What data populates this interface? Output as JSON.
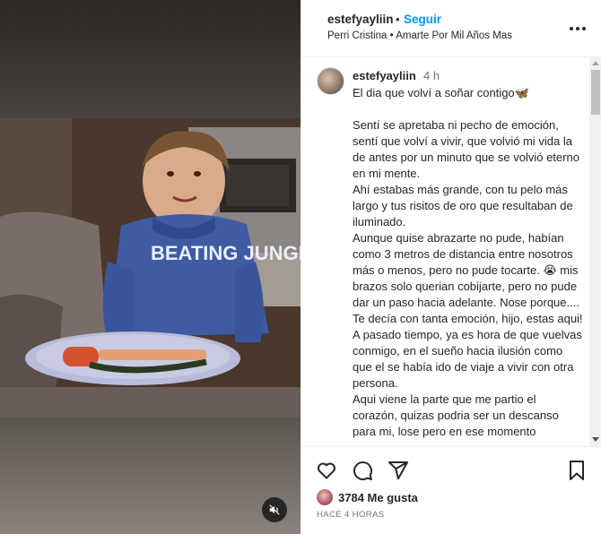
{
  "media": {
    "mute_icon": "speaker-muted-icon",
    "shirt_text": "BEATING JUNGLE"
  },
  "header": {
    "username": "estefyayliin",
    "separator": "•",
    "follow_label": "Seguir",
    "audio": "Perri Cristina • Amarte Por Mil Años Mas",
    "more_icon": "more-options-icon"
  },
  "comment": {
    "username": "estefyayliin",
    "time": "4 h",
    "caption": "El dia que volví a soñar contigo🦋\n\nSentí se apretaba ni pecho de emoción, sentí que volví a vivir, que volvió mi vida la de antes por un minuto que se volvió eterno en mi mente.\nAhí estabas más grande, con tu pelo más largo y tus risitos de oro que resultaban de iluminado.\nAunque quise abrazarte no pude, habían como 3 metros de distancia entre nosotros más o menos, pero no pude tocarte. 😭 mis brazos solo querian cobijarte, pero no pude dar un paso hacia adelante. Nose porque....\nTe decía con tanta emoción, hijo, estas aqui! A pasado tiempo, ya es hora de que vuelvas conmigo, en el sueño hacia ilusión como que el se había ido de viaje a vivir con otra persona.\nAqui viene la parte que me partio el corazón, quizas podria ser un descanso para mi, lose pero en ese momento"
  },
  "actions": {
    "like_icon": "heart-icon",
    "comment_icon": "comment-icon",
    "share_icon": "share-icon",
    "save_icon": "bookmark-icon",
    "likes": "3784 Me gusta",
    "posted": "HACE 4 HORAS"
  },
  "colors": {
    "follow": "#0095f6",
    "text": "#262626",
    "muted": "#737373"
  }
}
